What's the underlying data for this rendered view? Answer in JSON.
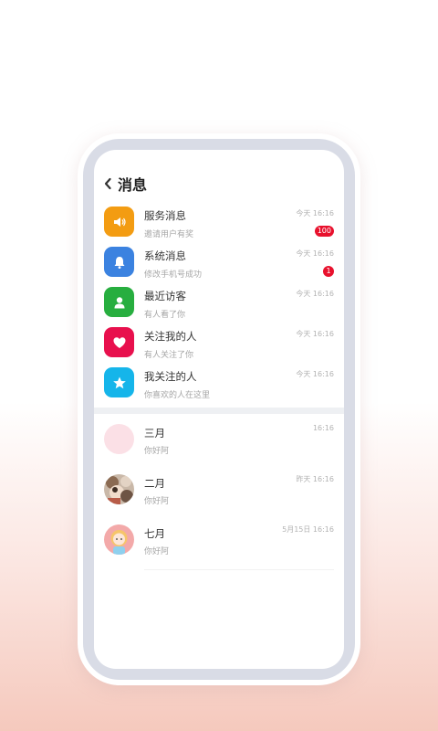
{
  "header": {
    "title": "消息"
  },
  "system_items": [
    {
      "name": "服务消息",
      "sub": "邀请用户有奖",
      "time": "今天 16:16",
      "badge": "100",
      "color": "#f39c12",
      "icon": "speaker-icon"
    },
    {
      "name": "系统消息",
      "sub": "修改手机号成功",
      "time": "今天 16:16",
      "badge": "1",
      "color": "#3b82e0",
      "icon": "bell-icon"
    },
    {
      "name": "最近访客",
      "sub": "有人看了你",
      "time": "今天 16:16",
      "badge": "",
      "color": "#27ae3f",
      "icon": "person-icon"
    },
    {
      "name": "关注我的人",
      "sub": "有人关注了你",
      "time": "今天 16:16",
      "badge": "",
      "color": "#e8104d",
      "icon": "heart-icon"
    },
    {
      "name": "我关注的人",
      "sub": "你喜欢的人在这里",
      "time": "今天 16:16",
      "badge": "",
      "color": "#15b5ea",
      "icon": "star-icon"
    }
  ],
  "chats": [
    {
      "name": "三月",
      "sub": "你好阿",
      "time": "16:16",
      "avatar": "blank-avatar"
    },
    {
      "name": "二月",
      "sub": "你好阿",
      "time": "昨天 16:16",
      "avatar": "photo-avatar"
    },
    {
      "name": "七月",
      "sub": "你好阿",
      "time": "5月15日 16:16",
      "avatar": "cartoon-girl-avatar"
    }
  ]
}
